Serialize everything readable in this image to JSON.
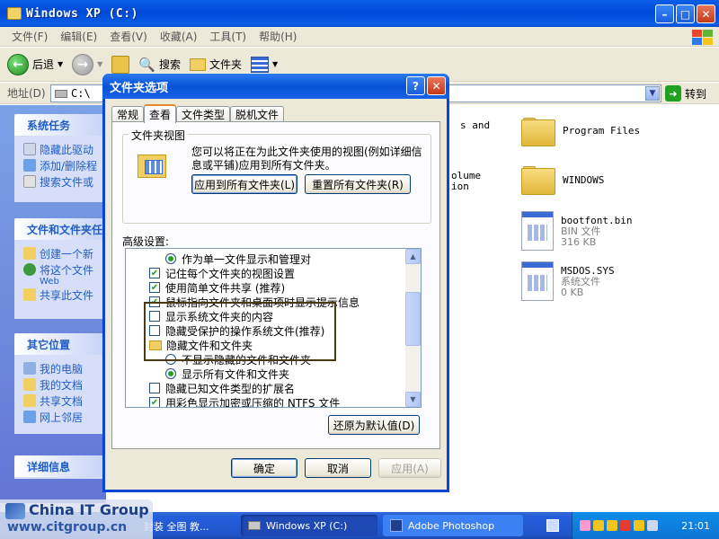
{
  "window": {
    "title": "Windows XP (C:)"
  },
  "menubar": {
    "items": [
      "文件(F)",
      "编辑(E)",
      "查看(V)",
      "收藏(A)",
      "工具(T)",
      "帮助(H)"
    ]
  },
  "toolbar": {
    "back_label": "后退",
    "search_label": "搜索",
    "folders_label": "文件夹"
  },
  "address": {
    "label": "地址(D)",
    "value": "C:\\",
    "go_label": "转到"
  },
  "taskpane": {
    "system_tasks": {
      "title": "系统任务",
      "items": [
        "隐藏此驱动",
        "添加/删除程",
        "搜索文件或"
      ]
    },
    "file_folder_tasks": {
      "title": "文件和文件夹任",
      "items": [
        "创建一个新",
        "将这个文件",
        "共享此文件"
      ],
      "sub": "Web"
    },
    "other_places": {
      "title": "其它位置",
      "items": [
        "我的电脑",
        "我的文档",
        "共享文档",
        "网上邻居"
      ]
    },
    "details": {
      "title": "详细信息"
    }
  },
  "filearea": {
    "fragments": [
      "s and",
      "olume",
      "ion"
    ],
    "files": [
      {
        "name": "Program Files"
      },
      {
        "name": "WINDOWS"
      },
      {
        "name": "bootfont.bin",
        "type": "BIN 文件",
        "size": "316 KB"
      },
      {
        "name": "MSDOS.SYS",
        "type": "系统文件",
        "size": "0 KB"
      }
    ]
  },
  "dialog": {
    "title": "文件夹选项",
    "help": "?",
    "close": "✕",
    "tabs": [
      "常规",
      "查看",
      "文件类型",
      "脱机文件"
    ],
    "active_tab": "查看",
    "folder_views": {
      "caption": "文件夹视图",
      "description": "您可以将正在为此文件夹使用的视图(例如详细信息或平铺)应用到所有文件夹。",
      "apply_all": "应用到所有文件夹(L)",
      "reset_all": "重置所有文件夹(R)"
    },
    "advanced_label": "高级设置:",
    "settings": [
      {
        "kind": "radio",
        "checked": true,
        "indent": 2,
        "label": "作为单一文件显示和管理对"
      },
      {
        "kind": "checkbox",
        "checked": true,
        "indent": 1,
        "label": "记住每个文件夹的视图设置"
      },
      {
        "kind": "checkbox",
        "checked": true,
        "indent": 1,
        "label": "使用简单文件共享 (推荐)"
      },
      {
        "kind": "checkbox",
        "checked": true,
        "indent": 1,
        "label": "鼠标指向文件夹和桌面项时显示提示信息"
      },
      {
        "kind": "checkbox",
        "checked": false,
        "indent": 1,
        "label": "显示系统文件夹的内容"
      },
      {
        "kind": "checkbox",
        "checked": false,
        "indent": 1,
        "label": "隐藏受保护的操作系统文件(推荐)"
      },
      {
        "kind": "folder",
        "checked": false,
        "indent": 1,
        "label": "隐藏文件和文件夹"
      },
      {
        "kind": "radio",
        "checked": false,
        "indent": 2,
        "label": "不显示隐藏的文件和文件夹"
      },
      {
        "kind": "radio",
        "checked": true,
        "indent": 2,
        "label": "显示所有文件和文件夹"
      },
      {
        "kind": "checkbox",
        "checked": false,
        "indent": 1,
        "label": "隐藏已知文件类型的扩展名"
      },
      {
        "kind": "checkbox",
        "checked": true,
        "indent": 1,
        "label": "用彩色显示加密或压缩的 NTFS 文件"
      }
    ],
    "restore_defaults": "还原为默认值(D)",
    "ok": "确定",
    "cancel": "取消",
    "apply": "应用(A)"
  },
  "taskbar": {
    "truncated_task": "封装 全图 教...",
    "tasks": [
      {
        "label": "Windows XP (C:)",
        "active": true
      },
      {
        "label": "Adobe Photoshop",
        "active": false
      }
    ],
    "clock": "21:01"
  },
  "watermark": {
    "line1": "China IT Group",
    "line2": "www.citgroup.cn"
  },
  "colors": {
    "titlebar": "#0a5ee8",
    "dialog_frame": "#0a46d6",
    "face": "#ece9d8",
    "check": "#21a121",
    "taskbar": "#245edb"
  }
}
